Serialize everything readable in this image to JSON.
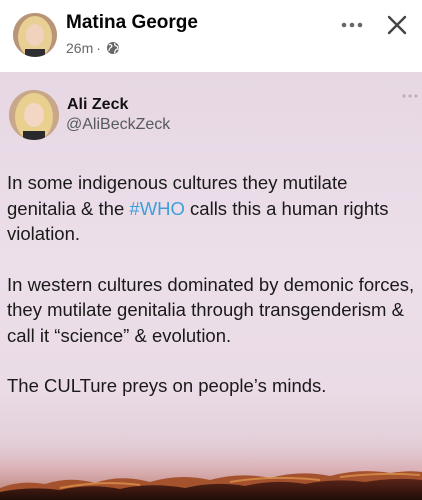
{
  "post": {
    "author_name": "Matina George",
    "time": "26m",
    "separator": "·",
    "privacy_icon": "globe-icon",
    "more_icon": "more-horizontal-icon",
    "close_icon": "close-icon"
  },
  "tweet": {
    "name": "Ali Zeck",
    "handle": "@AliBeckZeck",
    "p1_before": "In some indigenous cultures they mutilate genitalia & the ",
    "p1_hashtag": "#WHO",
    "p1_after": " calls this a human rights violation.",
    "p2": "In western cultures dominated by demonic forces, they mutilate genitalia through transgenderism & call it “science” & evolution.",
    "p3": "The CULTure preys on people’s minds."
  },
  "colors": {
    "hashtag": "#3fa0d9",
    "name": "#050505",
    "meta": "#65676b",
    "image_background": "#e9dae6"
  }
}
